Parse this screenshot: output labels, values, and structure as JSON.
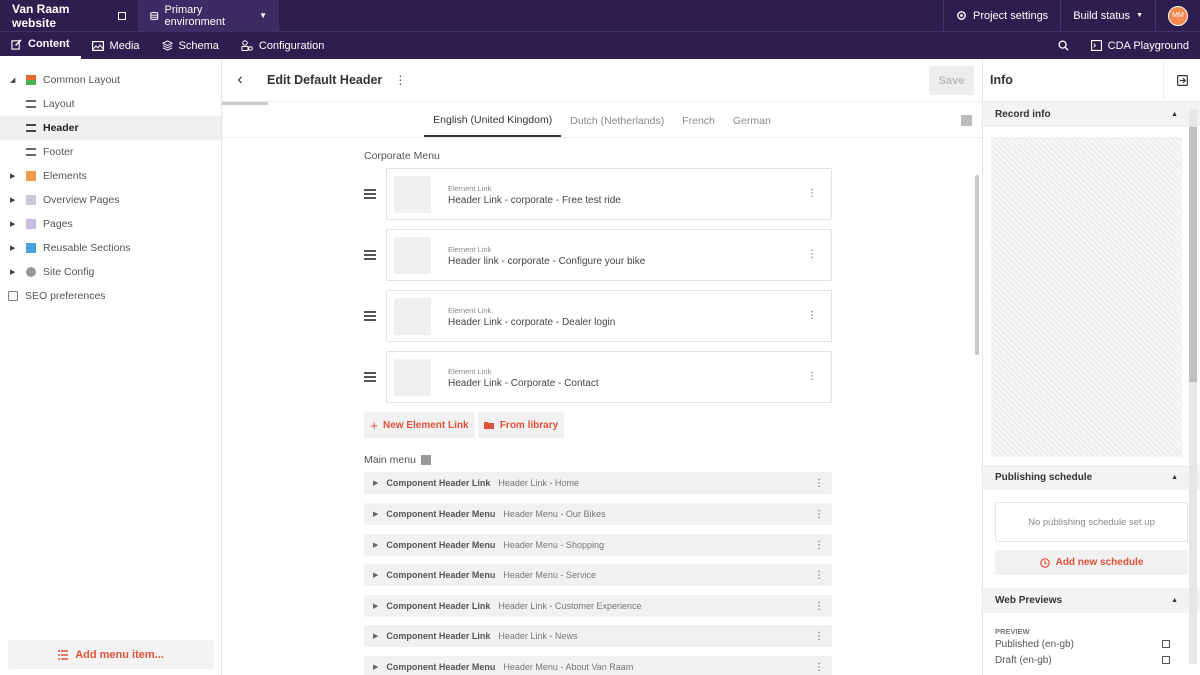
{
  "topbar": {
    "site_name": "Van Raam website",
    "environment": "Primary environment",
    "project_settings": "Project settings",
    "build_status": "Build status",
    "avatar_initials": "MM"
  },
  "navbar": {
    "tabs": [
      {
        "label": "Content",
        "icon": "pencil-icon"
      },
      {
        "label": "Media",
        "icon": "image-icon"
      },
      {
        "label": "Schema",
        "icon": "layers-icon"
      },
      {
        "label": "Configuration",
        "icon": "config-icon"
      }
    ],
    "cda_playground": "CDA Playground"
  },
  "sidebar": {
    "items": [
      {
        "label": "Common Layout",
        "expanded": true
      },
      {
        "label": "Layout"
      },
      {
        "label": "Header",
        "active": true
      },
      {
        "label": "Footer"
      },
      {
        "label": "Elements"
      },
      {
        "label": "Overview Pages"
      },
      {
        "label": "Pages"
      },
      {
        "label": "Reusable Sections"
      },
      {
        "label": "Site Config"
      },
      {
        "label": "SEO preferences"
      }
    ],
    "add_menu_item": "Add menu item..."
  },
  "editor": {
    "title": "Edit Default Header",
    "save_label": "Save",
    "locales": [
      "English (United Kingdom)",
      "Dutch (Netherlands)",
      "French",
      "German"
    ],
    "corporate_menu_label": "Corporate Menu",
    "corporate_items": [
      {
        "type": "Element Link",
        "name": "Header Link - corporate - Free test ride"
      },
      {
        "type": "Element Link",
        "name": "Header link - corporate - Configure your bike"
      },
      {
        "type": "Element Link",
        "name": "Header Link - corporate - Dealer login"
      },
      {
        "type": "Element Link",
        "name": "Header Link - Corporate - Contact"
      }
    ],
    "new_element_link": "New Element Link",
    "from_library": "From library",
    "main_menu_label": "Main menu",
    "main_items": [
      {
        "type": "Component Header Link",
        "name": "Header Link - Home"
      },
      {
        "type": "Component Header Menu",
        "name": "Header Menu - Our Bikes"
      },
      {
        "type": "Component Header Menu",
        "name": "Header Menu - Shopping"
      },
      {
        "type": "Component Header Menu",
        "name": "Header Menu - Service"
      },
      {
        "type": "Component Header Link",
        "name": "Header Link - Customer Experience"
      },
      {
        "type": "Component Header Link",
        "name": "Header Link - News"
      },
      {
        "type": "Component Header Menu",
        "name": "Header Menu - About Van Raam"
      }
    ]
  },
  "info": {
    "title": "Info",
    "record_info": "Record info",
    "publishing_schedule": "Publishing schedule",
    "no_schedule": "No publishing schedule set up",
    "add_schedule": "Add new schedule",
    "web_previews": "Web Previews",
    "preview_label": "PREVIEW",
    "previews": [
      "Published (en-gb)",
      "Draft (en-gb)"
    ]
  },
  "colors": {
    "header_bg": "#2e1e4f",
    "accent": "#e0523a",
    "avatar": "#f5894d"
  }
}
